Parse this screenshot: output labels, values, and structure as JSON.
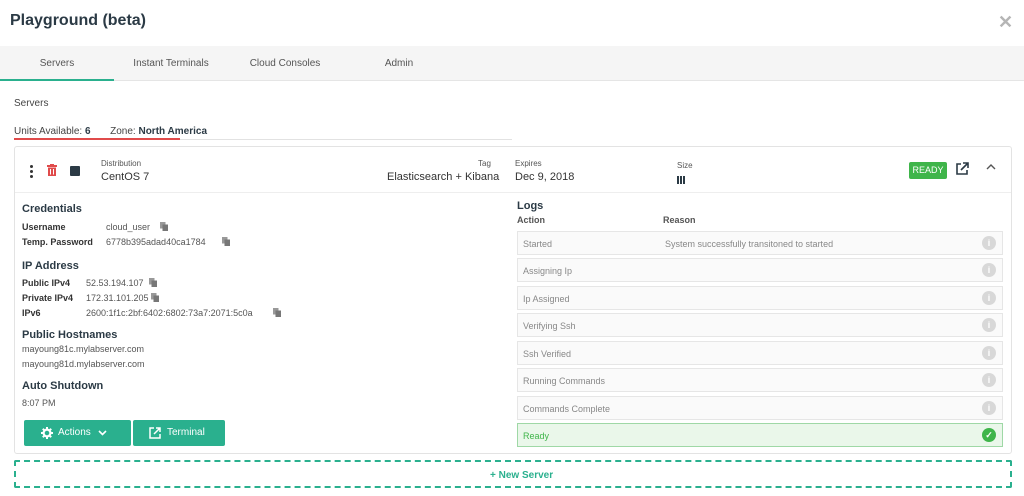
{
  "header": {
    "title": "Playground (beta)",
    "close_icon": "close-icon"
  },
  "tabs": [
    {
      "label": "Servers",
      "active": true
    },
    {
      "label": "Instant Terminals",
      "active": false
    },
    {
      "label": "Cloud Consoles",
      "active": false
    },
    {
      "label": "Admin",
      "active": false
    }
  ],
  "section": {
    "label": "Servers",
    "units_label": "Units Available:",
    "units_value": "6",
    "zone_label": "Zone:",
    "zone_value": "North America"
  },
  "server": {
    "distribution_label": "Distribution",
    "distribution": "CentOS 7",
    "tag_label": "Tag",
    "tag": "Elasticsearch + Kibana",
    "expires_label": "Expires",
    "expires": "Dec 9, 2018",
    "size_label": "Size",
    "status": "READY",
    "credentials": {
      "heading": "Credentials",
      "username_label": "Username",
      "username": "cloud_user",
      "password_label": "Temp. Password",
      "password": "6778b395adad40ca1784"
    },
    "ip": {
      "heading": "IP Address",
      "public_label": "Public IPv4",
      "public": "52.53.194.107",
      "private_label": "Private IPv4",
      "private": "172.31.101.205",
      "ipv6_label": "IPv6",
      "ipv6": "2600:1f1c:2bf:6402:6802:73a7:2071:5c0a"
    },
    "hostnames": {
      "heading": "Public Hostnames",
      "items": [
        "mayoung81c.mylabserver.com",
        "mayoung81d.mylabserver.com"
      ]
    },
    "shutdown": {
      "heading": "Auto Shutdown",
      "time": "8:07 PM"
    },
    "actions_label": "Actions",
    "terminal_label": "Terminal"
  },
  "logs": {
    "heading": "Logs",
    "col_action": "Action",
    "col_reason": "Reason",
    "rows": [
      {
        "action": "Started",
        "reason": "System successfully transitoned to started"
      },
      {
        "action": "Assigning Ip",
        "reason": ""
      },
      {
        "action": "Ip Assigned",
        "reason": ""
      },
      {
        "action": "Verifying Ssh",
        "reason": ""
      },
      {
        "action": "Ssh Verified",
        "reason": ""
      },
      {
        "action": "Running Commands",
        "reason": ""
      },
      {
        "action": "Commands Complete",
        "reason": ""
      },
      {
        "action": "Ready",
        "reason": ""
      }
    ]
  },
  "new_server_label": "+ New Server",
  "colors": {
    "accent": "#2ab08e",
    "ready": "#3fb54a",
    "danger": "#e04b4b"
  }
}
